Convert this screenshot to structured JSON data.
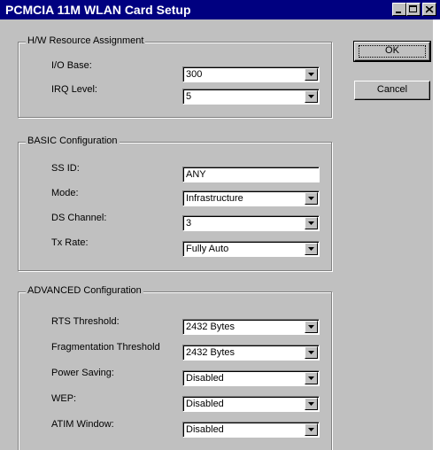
{
  "window": {
    "title": "PCMCIA 11M WLAN Card Setup"
  },
  "buttons": {
    "ok": "OK",
    "cancel": "Cancel"
  },
  "hw": {
    "title": "H/W Resource Assignment",
    "io_label": "I/O Base:",
    "io_value": "300",
    "irq_label": "IRQ Level:",
    "irq_value": "5"
  },
  "basic": {
    "title": "BASIC Configuration",
    "ssid_label": "SS ID:",
    "ssid_value": "ANY",
    "mode_label": "Mode:",
    "mode_value": "Infrastructure",
    "channel_label": "DS Channel:",
    "channel_value": "3",
    "txrate_label": "Tx Rate:",
    "txrate_value": "Fully Auto"
  },
  "advanced": {
    "title": "ADVANCED Configuration",
    "rts_label": "RTS Threshold:",
    "rts_value": "2432 Bytes",
    "frag_label": "Fragmentation Threshold",
    "frag_value": "2432 Bytes",
    "power_label": "Power Saving:",
    "power_value": "Disabled",
    "wep_label": "WEP:",
    "wep_value": "Disabled",
    "atim_label": "ATIM Window:",
    "atim_value": "Disabled"
  },
  "icons": {
    "minimize": "minimize-icon",
    "maximize": "maximize-icon",
    "close": "close-icon",
    "dropdown": "chevron-down-icon"
  }
}
